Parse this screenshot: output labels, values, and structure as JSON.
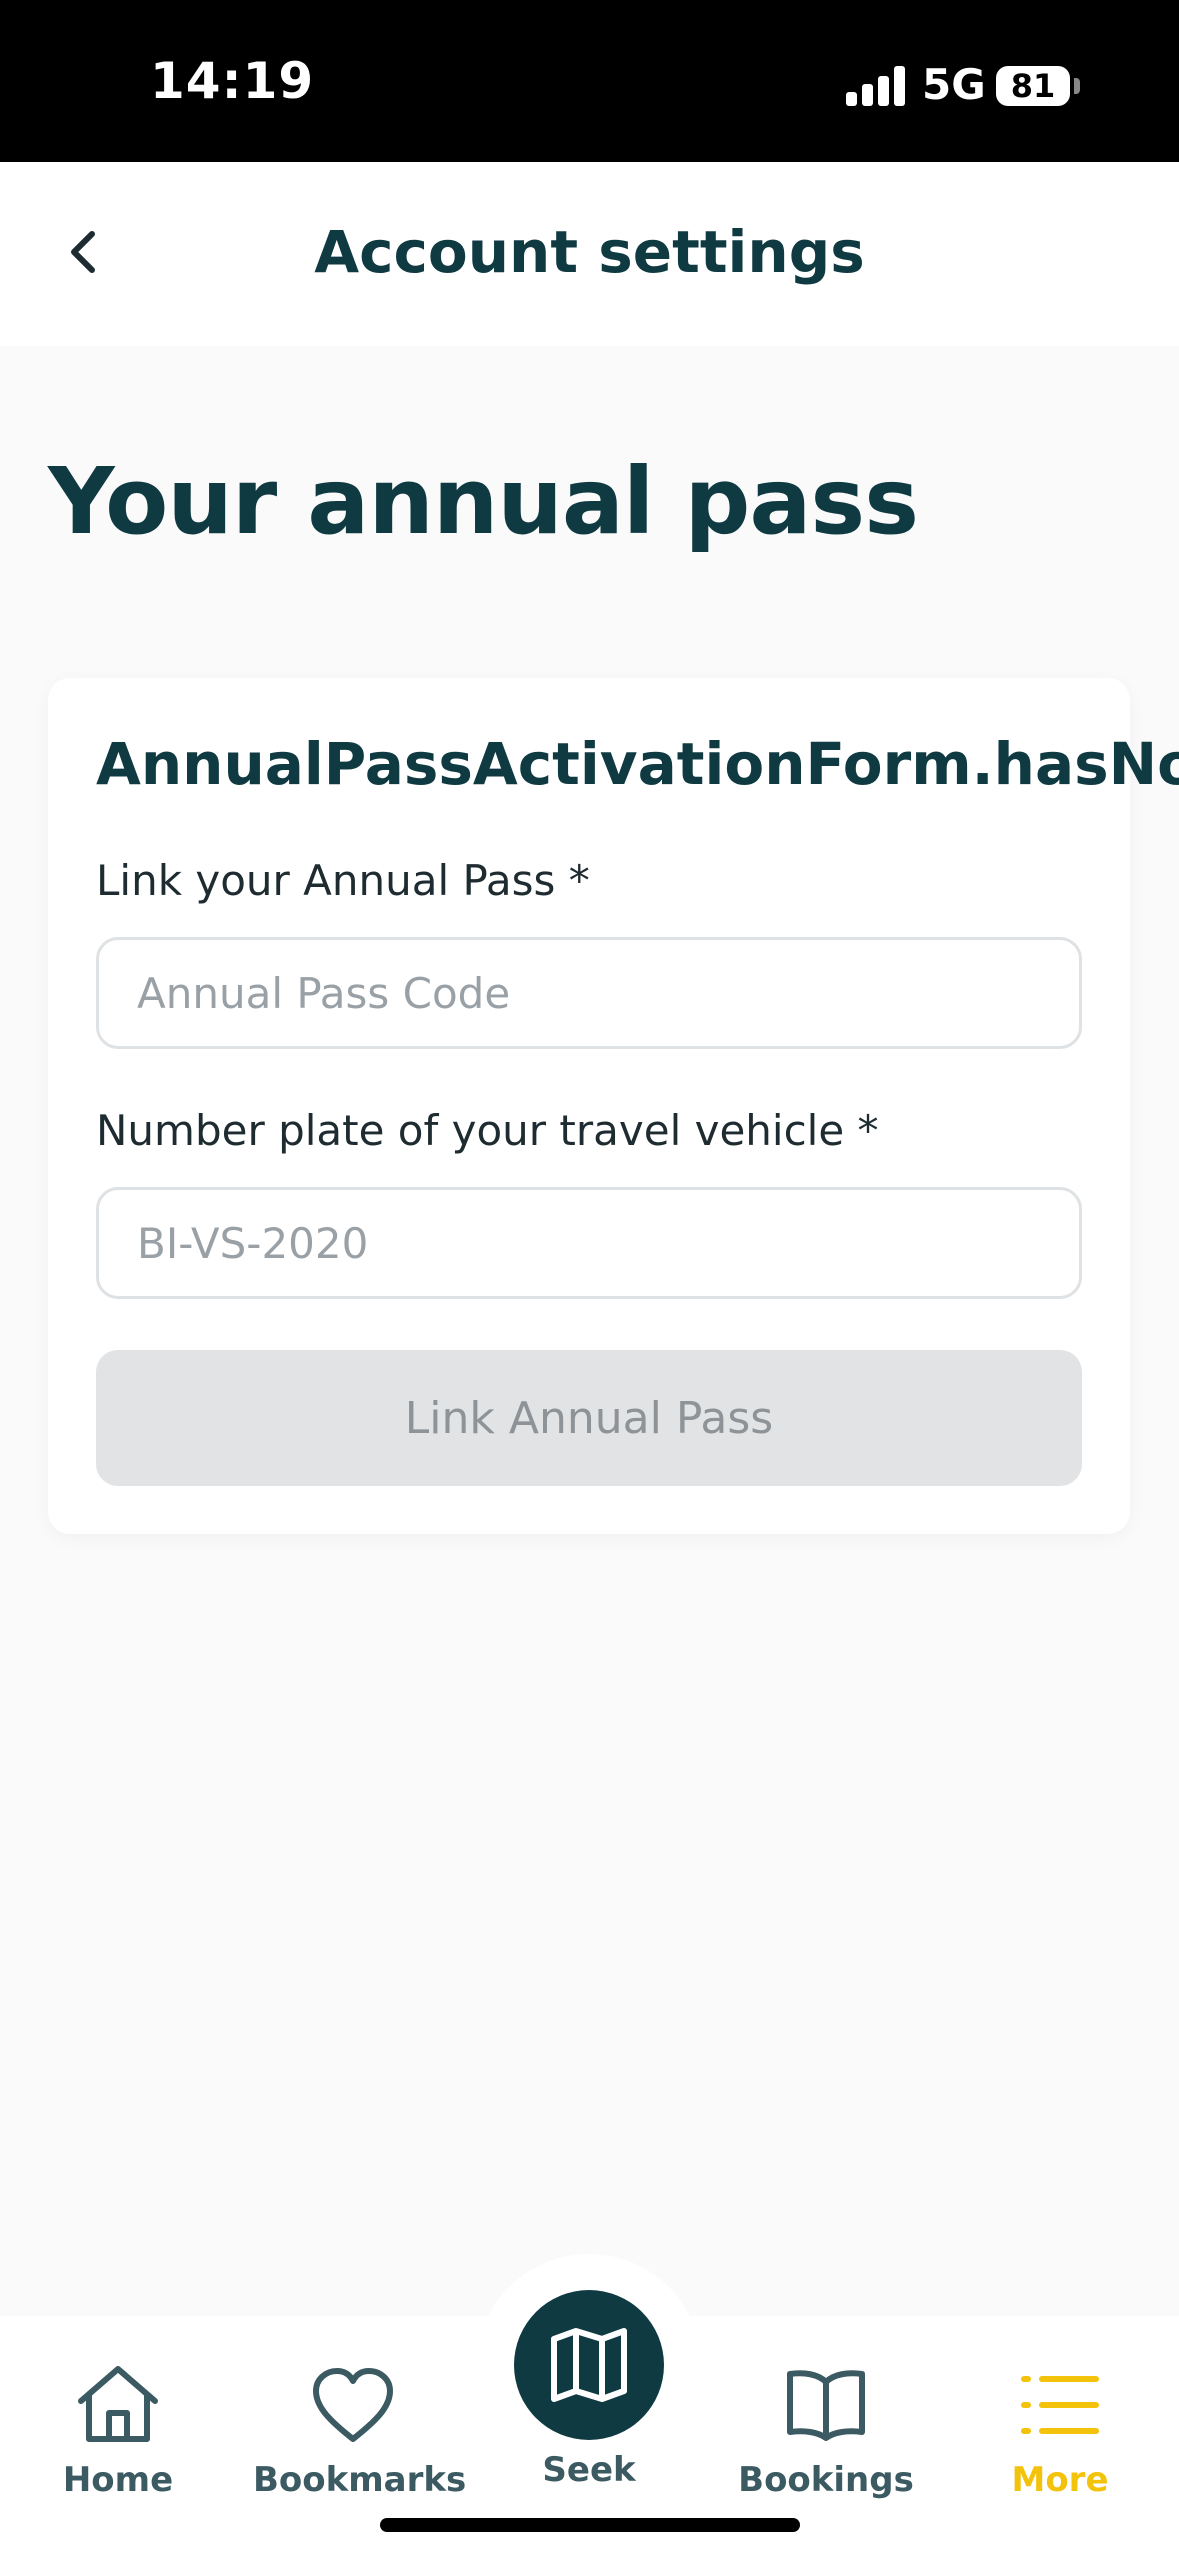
{
  "status_bar": {
    "time": "14:19",
    "network": "5G",
    "battery": "81"
  },
  "header": {
    "title": "Account settings"
  },
  "page": {
    "title": "Your annual pass"
  },
  "form": {
    "title": "AnnualPassActivationForm.hasNotAnnualPass",
    "pass_code_label": "Link your Annual Pass *",
    "pass_code_placeholder": "Annual Pass Code",
    "pass_code_value": "",
    "plate_label": "Number plate of your travel vehicle *",
    "plate_placeholder": "BI-VS-2020",
    "plate_value": "",
    "submit_label": "Link Annual Pass"
  },
  "tab_bar": {
    "items": [
      {
        "label": "Home",
        "icon": "home-icon"
      },
      {
        "label": "Bookmarks",
        "icon": "heart-icon"
      },
      {
        "label": "Seek",
        "icon": "map-icon"
      },
      {
        "label": "Bookings",
        "icon": "book-icon"
      },
      {
        "label": "More",
        "icon": "list-icon",
        "active": true
      }
    ]
  },
  "colors": {
    "primary": "#0f3a42",
    "accent": "#f3c20a",
    "disabled_button": "#e2e3e5",
    "background": "#fafafa"
  }
}
